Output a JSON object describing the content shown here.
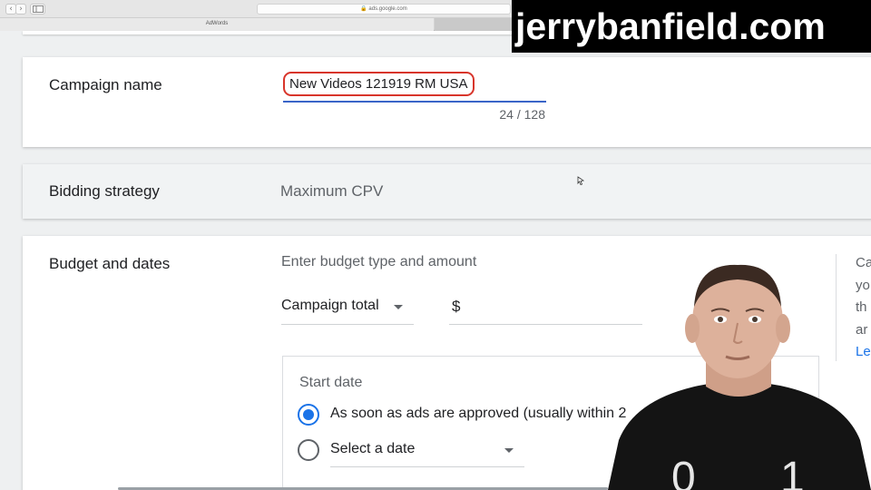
{
  "browser": {
    "url": "ads.google.com",
    "tabs": [
      "AdWords",
      ""
    ]
  },
  "form": {
    "campaign_name": {
      "label": "Campaign name",
      "value": "New Videos 121919 RM USA",
      "char_count": "24 / 128"
    },
    "bidding_strategy": {
      "label": "Bidding strategy",
      "value": "Maximum CPV"
    },
    "budget": {
      "label": "Budget and dates",
      "prompt": "Enter budget type and amount",
      "type_selected": "Campaign total",
      "currency_symbol": "$",
      "start_date": {
        "title": "Start date",
        "options": [
          "As soon as ads are approved (usually within 2",
          "Select a date"
        ],
        "selected_index": 0
      },
      "side_text": [
        "Ca",
        "yo",
        "th",
        "ar"
      ],
      "side_link": "Le"
    }
  },
  "overlay": {
    "watermark": "jerrybanfield.com",
    "shirt_digits": [
      "0",
      "1"
    ]
  },
  "colors": {
    "accent_blue": "#1a73e8",
    "highlight_red": "#d8352b",
    "underline_blue": "#3a65c8"
  }
}
